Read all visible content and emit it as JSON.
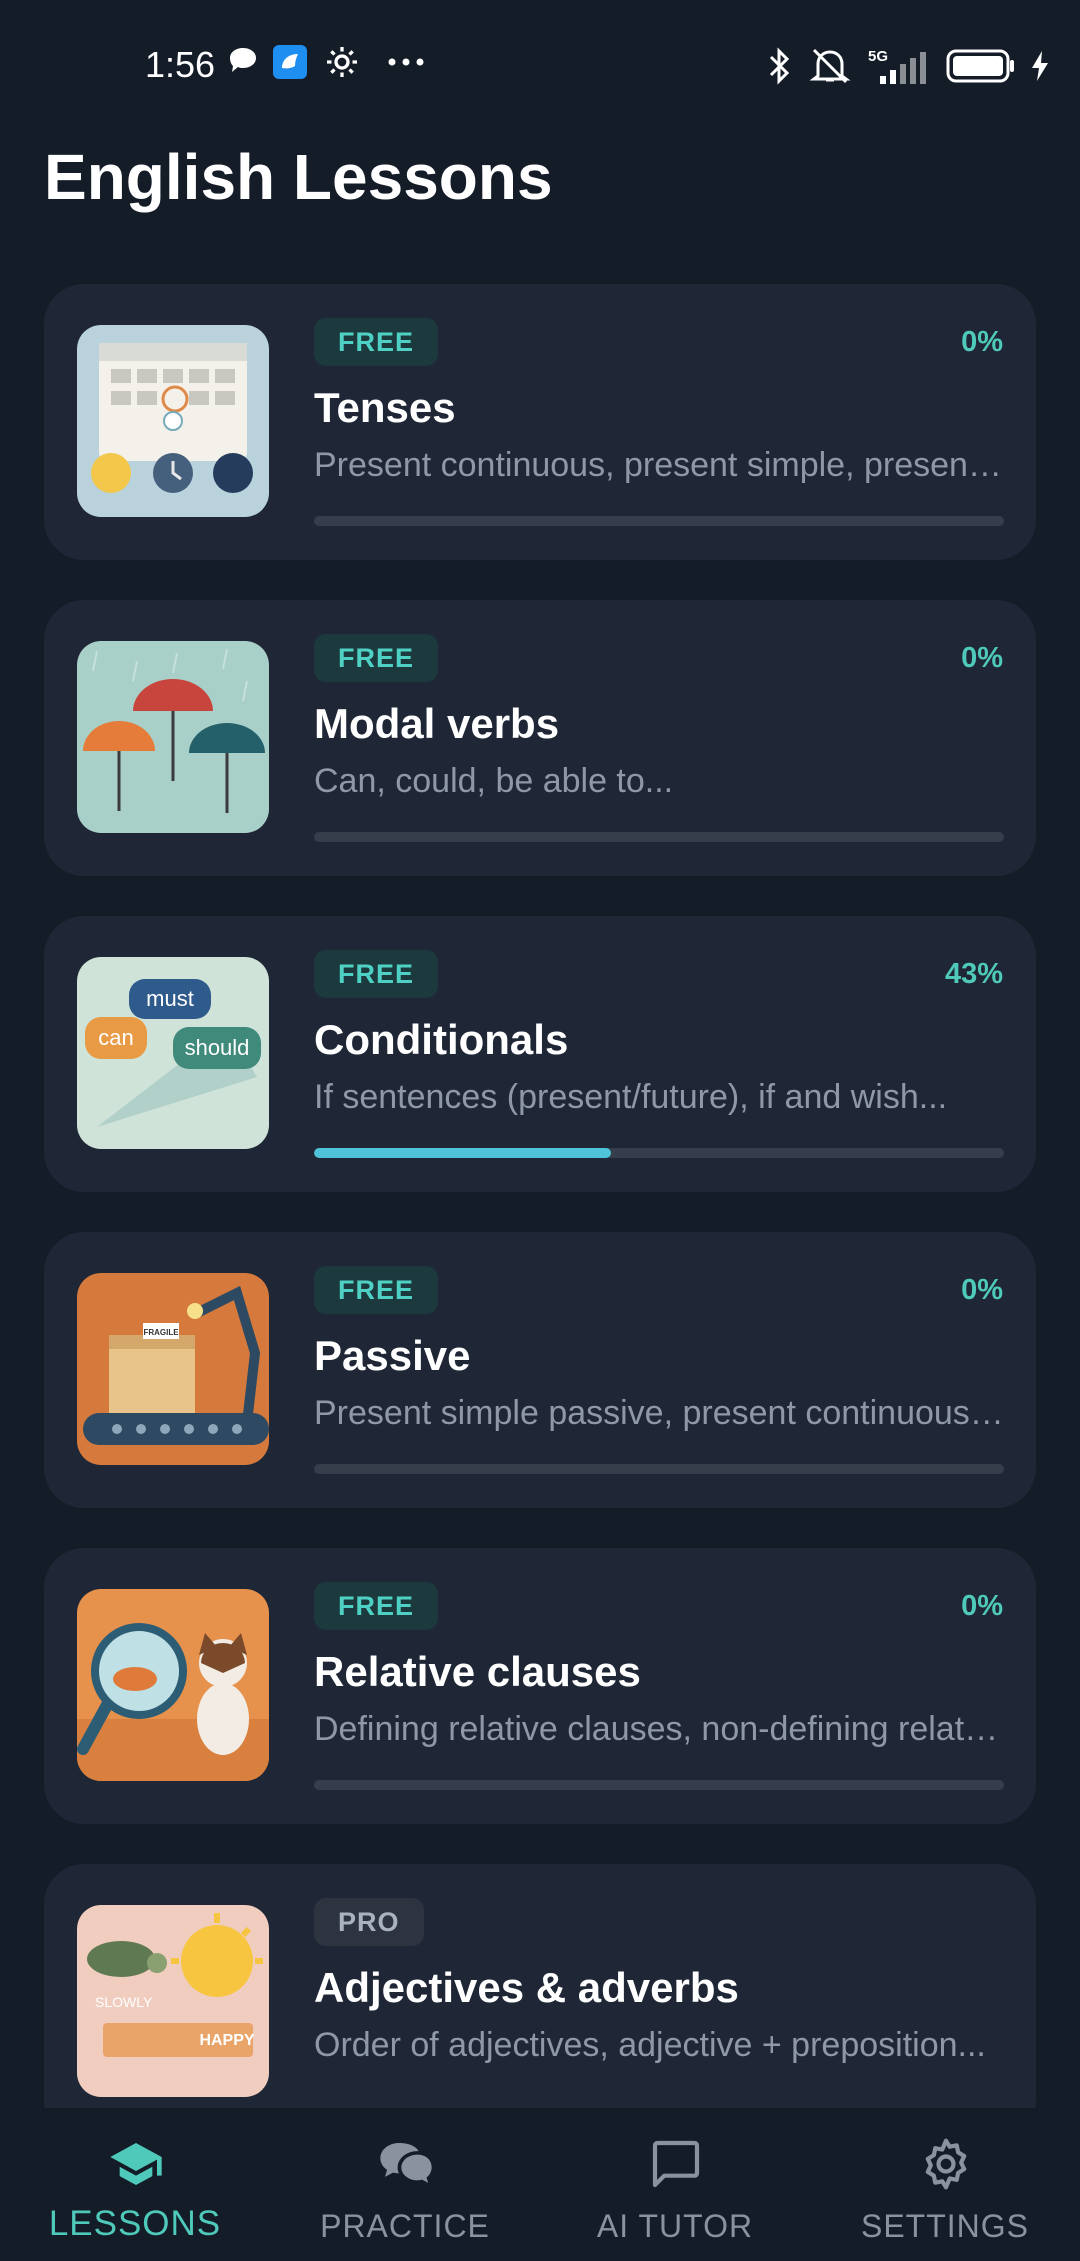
{
  "status_bar": {
    "time": "1:56",
    "left_icons": [
      "chat-bubble-icon",
      "app-notification-icon",
      "gear-icon",
      "more-dots-icon"
    ],
    "right_icons": [
      "bluetooth-icon",
      "mute-bell-icon",
      "signal-5g-icon",
      "battery-icon",
      "charging-bolt-icon"
    ],
    "network": "5G"
  },
  "page": {
    "title": "English Lessons"
  },
  "lessons": [
    {
      "badge": "FREE",
      "percent": "0%",
      "progress": 0,
      "title": "Tenses",
      "description": "Present continuous, present simple, present perfect...",
      "thumb": "calendar-clock-image"
    },
    {
      "badge": "FREE",
      "percent": "0%",
      "progress": 0,
      "title": "Modal verbs",
      "description": "Can, could, be able to...",
      "thumb": "umbrellas-image"
    },
    {
      "badge": "FREE",
      "percent": "43%",
      "progress": 0.43,
      "title": "Conditionals",
      "description": "If sentences (present/future), if and wish...",
      "thumb": "speech-bubbles-image",
      "thumb_words": [
        "must",
        "can",
        "should"
      ]
    },
    {
      "badge": "FREE",
      "percent": "0%",
      "progress": 0,
      "title": "Passive",
      "description": "Present simple passive, present continuous passive...",
      "thumb": "conveyor-box-image",
      "thumb_words": [
        "FRAGILE"
      ]
    },
    {
      "badge": "FREE",
      "percent": "0%",
      "progress": 0,
      "title": "Relative clauses",
      "description": "Defining relative clauses, non-defining relative clauses...",
      "thumb": "cat-magnifier-image"
    },
    {
      "badge": "PRO",
      "percent": "",
      "progress": null,
      "title": "Adjectives & adverbs",
      "description": "Order of adjectives, adjective + preposition...",
      "thumb": "turtle-sun-image",
      "thumb_words": [
        "SLOWLY",
        "HAPPY"
      ]
    }
  ],
  "bottom_nav": [
    {
      "label": "LESSONS",
      "icon": "graduation-cap-icon",
      "active": true
    },
    {
      "label": "PRACTICE",
      "icon": "chat-bubbles-icon",
      "active": false
    },
    {
      "label": "AI TUTOR",
      "icon": "message-square-icon",
      "active": false
    },
    {
      "label": "SETTINGS",
      "icon": "gear-icon",
      "active": false
    }
  ],
  "colors": {
    "background": "#141c28",
    "card": "#1f2736",
    "accent": "#4fc9b9",
    "progress_fill": "#4fc3d8",
    "badge_free_bg": "#1c3a3d",
    "badge_pro_bg": "#2d3440"
  }
}
